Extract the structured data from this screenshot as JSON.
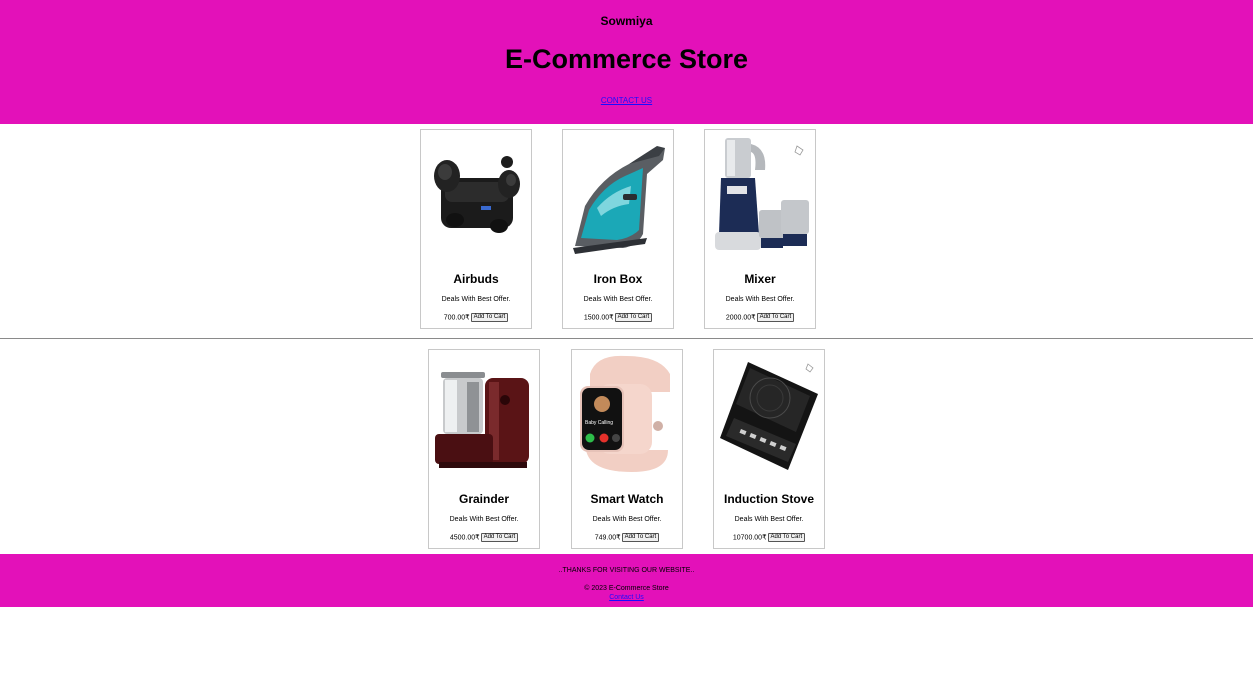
{
  "header": {
    "owner": "Sowmiya",
    "title": "E-Commerce Store",
    "contact_link": "CONTACT US"
  },
  "products": [
    {
      "name": "Airbuds",
      "desc": "Deals With Best Offer.",
      "price": "700.00₹",
      "button": "Add To Cart",
      "icon": "earbuds-image"
    },
    {
      "name": "Iron Box",
      "desc": "Deals With Best Offer.",
      "price": "1500.00₹",
      "button": "Add To Cart",
      "icon": "iron-box-image"
    },
    {
      "name": "Mixer",
      "desc": "Deals With Best Offer.",
      "price": "2000.00₹",
      "button": "Add To Cart",
      "icon": "mixer-image"
    },
    {
      "name": "Grainder",
      "desc": "Deals With Best Offer.",
      "price": "4500.00₹",
      "button": "Add To Cart",
      "icon": "grinder-image"
    },
    {
      "name": "Smart Watch",
      "desc": "Deals With Best Offer.",
      "price": "749.00₹",
      "button": "Add To Cart",
      "icon": "smart-watch-image"
    },
    {
      "name": "Induction Stove",
      "desc": "Deals With Best Offer.",
      "price": "10700.00₹",
      "button": "Add To Cart",
      "icon": "induction-stove-image"
    }
  ],
  "watch_screen": {
    "name": "Baby Calling"
  },
  "footer": {
    "thanks": "..THANKS FOR VISITING OUR WEBSITE..",
    "copyright": "© 2023 E-Commerce Store",
    "contact_link": "Contact Us"
  },
  "colors": {
    "brand": "#e311b9",
    "link": "#1a0dff"
  }
}
